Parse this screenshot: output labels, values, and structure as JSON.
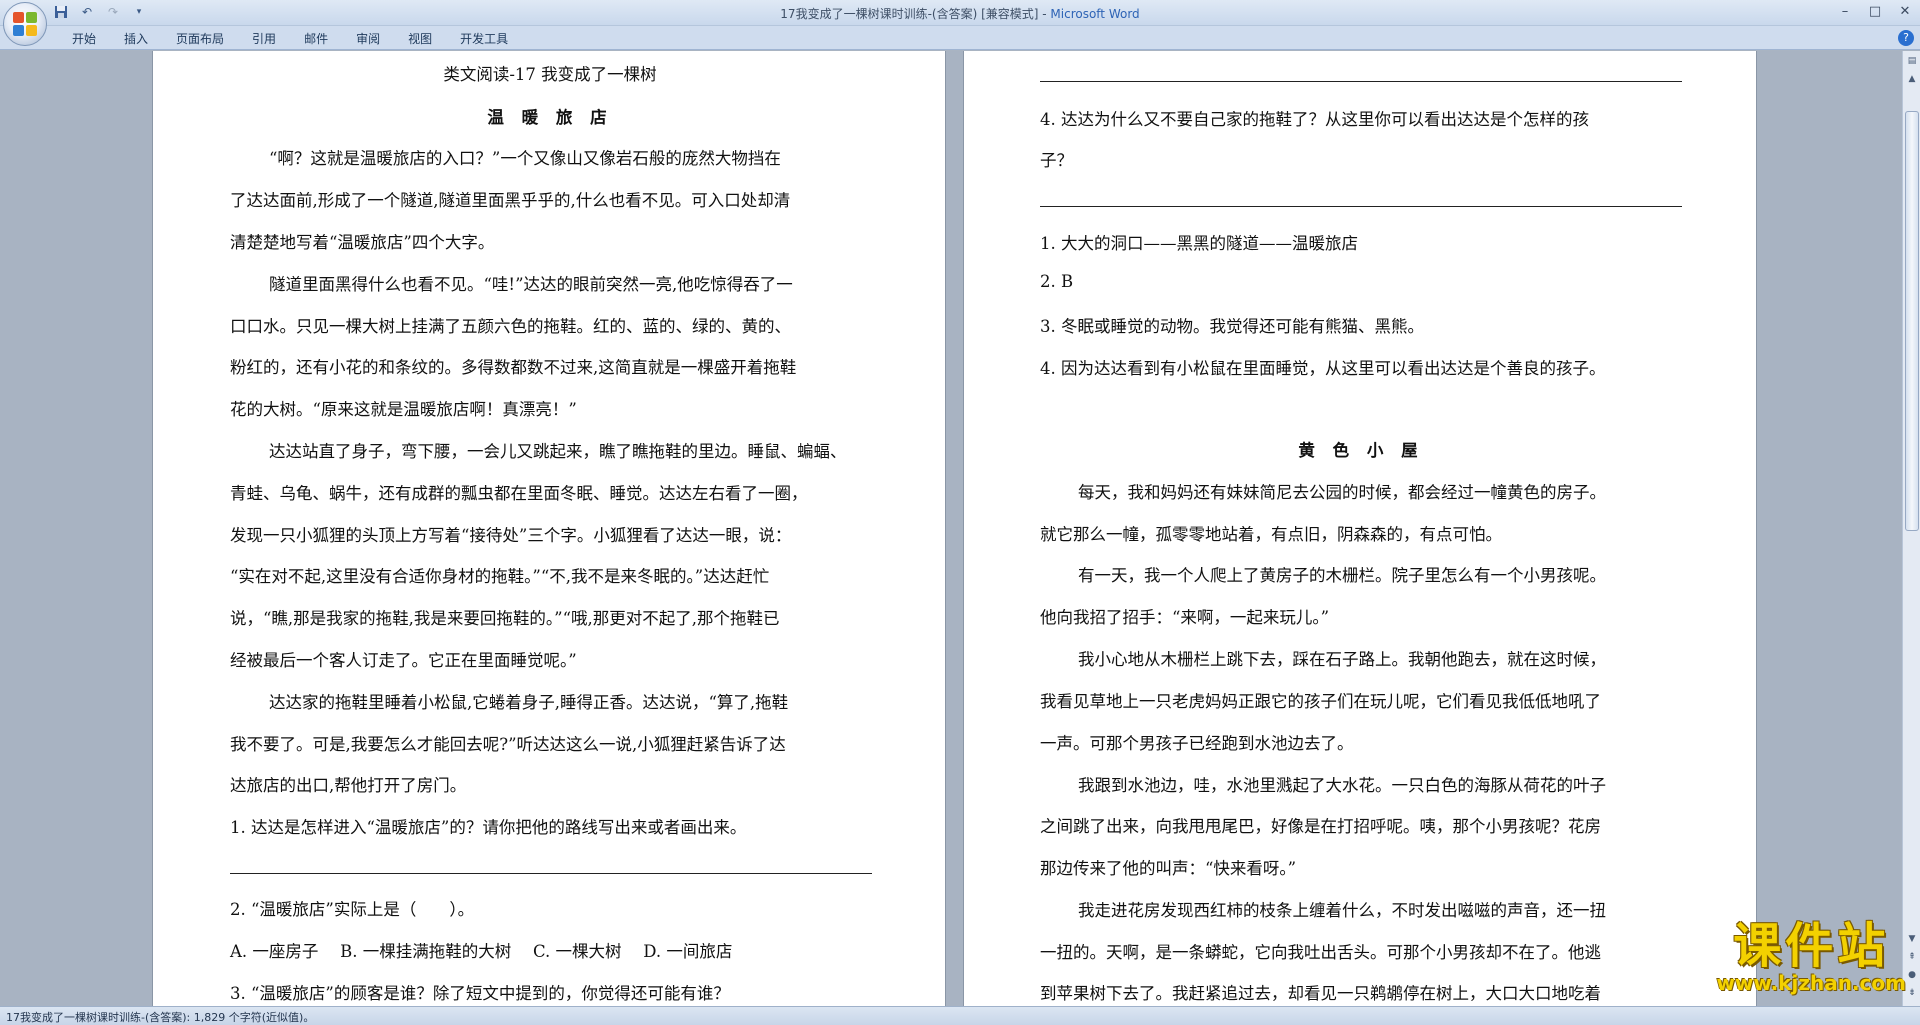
{
  "window": {
    "title": "17我变成了一棵树课时训练-(含答案) [兼容模式] - ",
    "brand": "Microsoft Word",
    "minimize": "–",
    "maximize": "□",
    "close": "✕"
  },
  "qat": {
    "save_icon": "floppy-disk",
    "undo_icon": "undo",
    "redo_icon": "redo",
    "customize_icon": "dropdown"
  },
  "ribbon": {
    "tabs": [
      "开始",
      "插入",
      "页面布局",
      "引用",
      "邮件",
      "审阅",
      "视图",
      "开发工具"
    ],
    "help": "?"
  },
  "left_page": {
    "header": "类文阅读-17 我变成了一棵树",
    "title": "温 暖 旅 店",
    "lines": [
      "“啊？这就是温暖旅店的入口？”一个又像山又像岩石般的庞然大物挡在",
      "了达达面前,形成了一个隧道,隧道里面黑乎乎的,什么也看不见。可入口处却清",
      "清楚楚地写着“温暖旅店”四个大字。",
      "隧道里面黑得什么也看不见。“哇!”达达的眼前突然一亮,他吃惊得吞了一",
      "口口水。只见一棵大树上挂满了五颜六色的拖鞋。红的、蓝的、绿的、黄的、",
      "粉红的，还有小花的和条纹的。多得数都数不过来,这简直就是一棵盛开着拖鞋",
      "花的大树。“原来这就是温暖旅店啊！真漂亮！”",
      "达达站直了身子，弯下腰，一会儿又跳起来，瞧了瞧拖鞋的里边。睡鼠、蝙蝠、",
      "青蛙、乌龟、蜗牛，还有成群的瓢虫都在里面冬眠、睡觉。达达左右看了一圈，",
      "发现一只小狐狸的头顶上方写着“接待处”三个字。小狐狸看了达达一眼，说：",
      "“实在对不起,这里没有合适你身材的拖鞋。”“不,我不是来冬眠的。”达达赶忙",
      "说，“瞧,那是我家的拖鞋,我是来要回拖鞋的。”“哦,那更对不起了,那个拖鞋已",
      "经被最后一个客人订走了。它正在里面睡觉呢。”",
      "达达家的拖鞋里睡着小松鼠,它蜷着身子,睡得正香。达达说，“算了,拖鞋",
      "我不要了。可是,我要怎么才能回去呢?”听达达这么一说,小狐狸赶紧告诉了达",
      "达旅店的出口,帮他打开了房门。"
    ],
    "q1": "1. 达达是怎样进入“温暖旅店”的？请你把他的路线写出来或者画出来。",
    "q2": "2. “温暖旅店”实际上是（　　）。",
    "q2_options": "A. 一座房子　 B. 一棵挂满拖鞋的大树　 C. 一棵大树　 D. 一间旅店",
    "q3": "3. “温暖旅店”的顾客是谁？除了短文中提到的，你觉得还可能有谁？"
  },
  "right_page": {
    "q4_line1": "4. 达达为什么又不要自己家的拖鞋了？从这里你可以看出达达是个怎样的孩",
    "q4_line2": "子？",
    "answers": [
      "1. 大大的洞口——黑黑的隧道——温暖旅店",
      "2. B",
      "3. 冬眠或睡觉的动物。我觉得还可能有熊猫、黑熊。",
      "4. 因为达达看到有小松鼠在里面睡觉，从这里可以看出达达是个善良的孩子。"
    ],
    "title": "黄 色 小 屋",
    "lines": [
      "每天，我和妈妈还有妹妹简尼去公园的时候，都会经过一幢黄色的房子。",
      "就它那么一幢，孤零零地站着，有点旧，阴森森的，有点可怕。",
      "有一天，我一个人爬上了黄房子的木栅栏。院子里怎么有一个小男孩呢。",
      "他向我招了招手：“来啊，一起来玩儿。”",
      "我小心地从木栅栏上跳下去，踩在石子路上。我朝他跑去，就在这时候，",
      "我看见草地上一只老虎妈妈正跟它的孩子们在玩儿呢，它们看见我低低地吼了",
      "一声。可那个男孩子已经跑到水池边去了。",
      "我跟到水池边，哇，水池里溅起了大水花。一只白色的海豚从荷花的叶子",
      "之间跳了出来，向我甩甩尾巴，好像是在打招呼呢。咦，那个小男孩呢？花房",
      "那边传来了他的叫声：“快来看呀。”",
      "我走进花房发现西红柿的枝条上缠着什么，不时发出嗞嗞的声音，还一扭",
      "一扭的。天啊，是一条蟒蛇，它向我吐出舌头。可那个小男孩却不在了。他逃",
      "到苹果树下去了。我赶紧追过去，却看见一只鹈鹕停在树上，大口大口地吃着"
    ]
  },
  "status": {
    "text": "17我变成了一棵树课时训练-(含答案): 1,829 个字符(近似值)。"
  },
  "watermark": {
    "main": "课件站",
    "url": "www.kjzhan.com"
  },
  "colors": {
    "accent": "#2d63b5",
    "watermark": "#f3d100"
  }
}
